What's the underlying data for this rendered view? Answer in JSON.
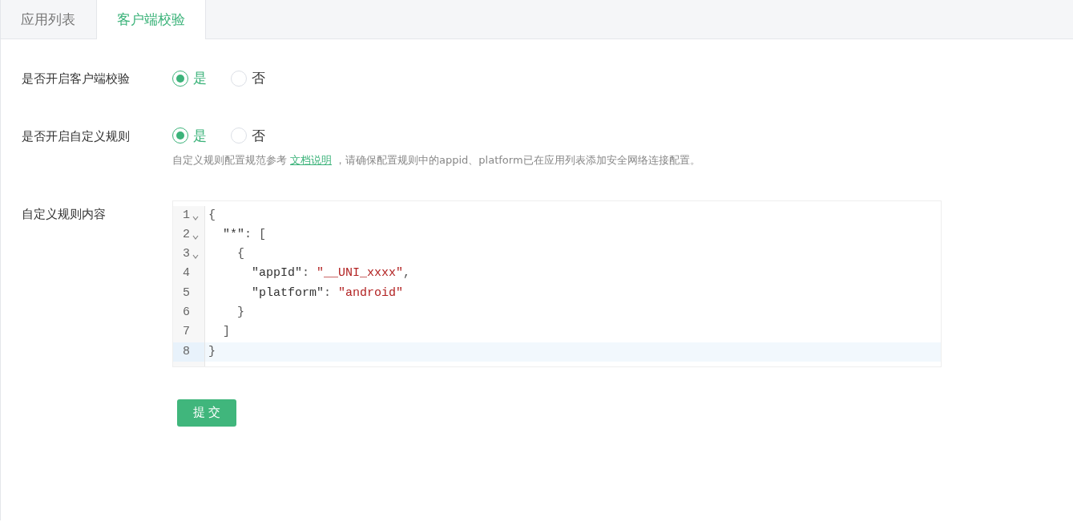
{
  "tabs": [
    {
      "label": "应用列表",
      "selected": false
    },
    {
      "label": "客户端校验",
      "selected": true
    }
  ],
  "settings": [
    {
      "label": "是否开启客户端校验",
      "options": [
        {
          "label": "是",
          "selected": true
        },
        {
          "label": "否",
          "selected": false
        }
      ]
    },
    {
      "label": "是否开启自定义规则",
      "options": [
        {
          "label": "是",
          "selected": true
        },
        {
          "label": "否",
          "selected": false
        }
      ],
      "help": {
        "before": "自定义规则配置规范参考",
        "link": "文档说明",
        "after": "，请确保配置规则中的appid、platform已在应用列表添加安全网络连接配置。"
      }
    }
  ],
  "editor": {
    "label": "自定义规则内容",
    "lines": [
      {
        "number": "1",
        "foldable": true,
        "active": false,
        "tokens": [
          {
            "kind": "punct",
            "text": "{"
          }
        ]
      },
      {
        "number": "2",
        "foldable": true,
        "active": false,
        "tokens": [
          {
            "kind": "key",
            "text": "  \"*\""
          },
          {
            "kind": "punct",
            "text": ": ["
          }
        ]
      },
      {
        "number": "3",
        "foldable": true,
        "active": false,
        "tokens": [
          {
            "kind": "punct",
            "text": "    {"
          }
        ]
      },
      {
        "number": "4",
        "foldable": false,
        "active": false,
        "tokens": [
          {
            "kind": "key",
            "text": "      \"appId\""
          },
          {
            "kind": "punct",
            "text": ": "
          },
          {
            "kind": "string",
            "text": "\"__UNI_xxxx\""
          },
          {
            "kind": "punct",
            "text": ","
          }
        ]
      },
      {
        "number": "5",
        "foldable": false,
        "active": false,
        "tokens": [
          {
            "kind": "key",
            "text": "      \"platform\""
          },
          {
            "kind": "punct",
            "text": ": "
          },
          {
            "kind": "string",
            "text": "\"android\""
          }
        ]
      },
      {
        "number": "6",
        "foldable": false,
        "active": false,
        "tokens": [
          {
            "kind": "punct",
            "text": "    }"
          }
        ]
      },
      {
        "number": "7",
        "foldable": false,
        "active": false,
        "tokens": [
          {
            "kind": "punct",
            "text": "  ]"
          }
        ]
      },
      {
        "number": "8",
        "foldable": false,
        "active": true,
        "tokens": [
          {
            "kind": "punct",
            "text": "}"
          }
        ]
      }
    ]
  },
  "submit": "提 交"
}
